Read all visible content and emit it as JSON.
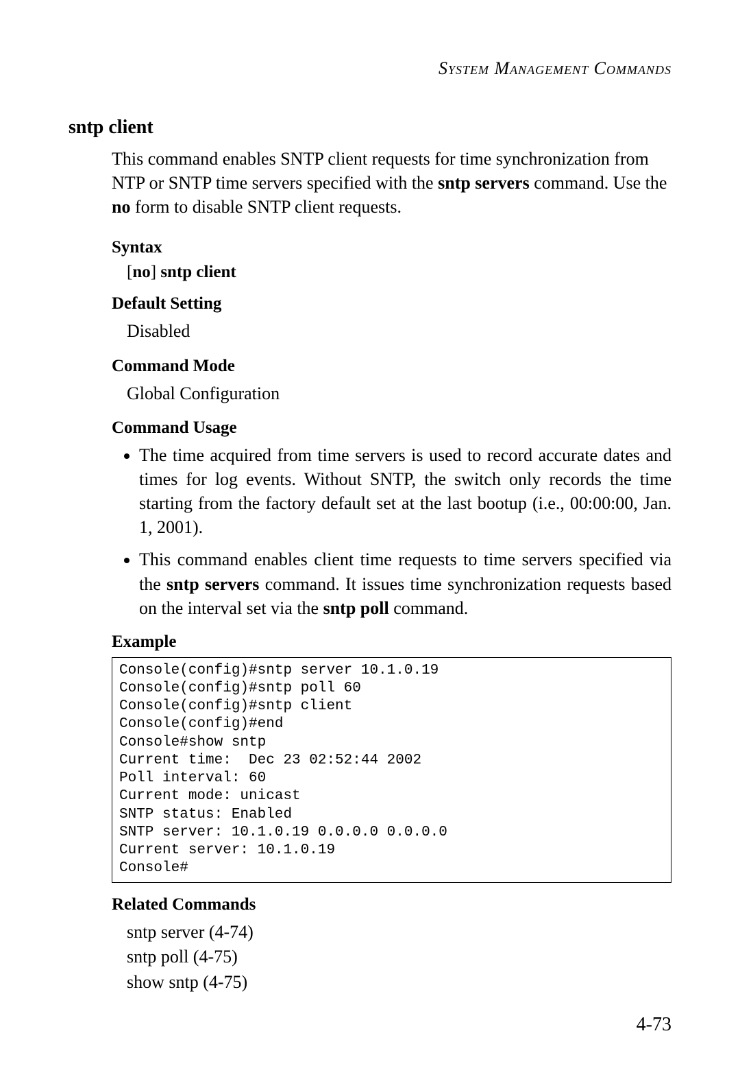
{
  "header": "System Management Commands",
  "command": {
    "title": "sntp client",
    "description_parts": {
      "p1": "This command enables SNTP client requests for time synchronization from NTP or SNTP time servers specified with the ",
      "b1": "sntp servers",
      "p2": " command. Use the ",
      "b2": "no",
      "p3": " form to disable SNTP client requests."
    }
  },
  "labels": {
    "syntax": "Syntax",
    "default_setting": "Default Setting",
    "command_mode": "Command Mode",
    "command_usage": "Command Usage",
    "example": "Example",
    "related_commands": "Related Commands"
  },
  "syntax": {
    "open": "[",
    "no": "no",
    "close": "]",
    "rest": " sntp client"
  },
  "default_setting_value": "Disabled",
  "command_mode_value": "Global Configuration",
  "usage": {
    "item1": "The time acquired from time servers is used to record accurate dates and times for log events. Without SNTP, the switch only records the time starting from the factory default set at the last bootup (i.e., 00:00:00, Jan. 1, 2001).",
    "item2": {
      "p1": "This command enables client time requests to time servers specified via the ",
      "b1": "sntp servers",
      "p2": " command. It issues time synchronization requests based on the interval set via the ",
      "b2": "sntp poll",
      "p3": " command."
    }
  },
  "example_code": "Console(config)#sntp server 10.1.0.19\nConsole(config)#sntp poll 60\nConsole(config)#sntp client\nConsole(config)#end\nConsole#show sntp\nCurrent time:  Dec 23 02:52:44 2002\nPoll interval: 60\nCurrent mode: unicast\nSNTP status: Enabled\nSNTP server: 10.1.0.19 0.0.0.0 0.0.0.0\nCurrent server: 10.1.0.19\nConsole#",
  "related": {
    "r1": "sntp server (4-74)",
    "r2": "sntp poll (4-75)",
    "r3": "show sntp (4-75)"
  },
  "page_number": "4-73"
}
